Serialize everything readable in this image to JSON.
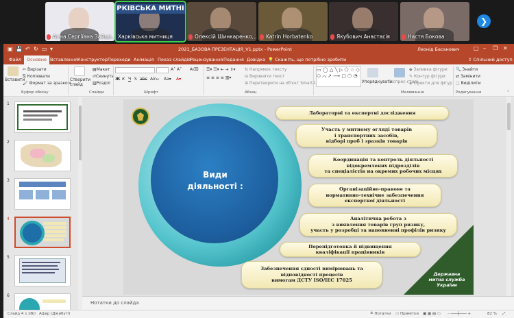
{
  "participants": [
    {
      "name": "Анна Сергіївна Зайце...",
      "muted": true,
      "bg": "#e9e9ef"
    },
    {
      "name": "Харківська митниця",
      "muted": false,
      "bg": "#1f2f4f",
      "banner": "РКІВСЬКА МИТНІ",
      "active": true
    },
    {
      "name": "Олексій Шинкаренко,...",
      "muted": true,
      "bg": "#5a4a3c"
    },
    {
      "name": "Katrin Horbatenko",
      "muted": true,
      "bg": "#6b5a3a"
    },
    {
      "name": "Якубович Анастасія",
      "muted": true,
      "bg": "#3a2f2f"
    },
    {
      "name": "Настя Бокова",
      "muted": true,
      "bg": "#7a6b66"
    }
  ],
  "titlebar": {
    "document": "2021_БАЗОВА ПРЕЗЕНТАЦІЯ_V1.pptx - PowerPoint",
    "user": "Леонід Басанович"
  },
  "tabs": [
    "Файл",
    "Основне",
    "Вставлення",
    "Конструктор",
    "Переходи",
    "Анімація",
    "Показ слайдів",
    "Рецензування",
    "Подання",
    "Довідка",
    "Скажіть, що потрібно зробити"
  ],
  "share_label": "Спільний доступ",
  "ribbon": {
    "paste": "Вставити",
    "cut": "Вирізати",
    "copy": "Копіювати",
    "format_painter": "Формат за зразком",
    "clipboard_group": "Буфер обміну",
    "new_slide": "Створити слайд",
    "layout": "Макет",
    "reset": "Скинути",
    "section": "Розділ",
    "slides_group": "Слайди",
    "font_group": "Шрифт",
    "text_direction": "Напрямок тексту",
    "align_text": "Вирівняти текст",
    "convert_smartart": "Перетворити на об'єкт SmartArt",
    "paragraph_group": "Абзац",
    "arrange": "Упорядкувати",
    "quick_styles": "Експрес-стилі",
    "shape_fill": "Заливка фігури",
    "shape_outline": "Контур фігури",
    "shape_effects": "Ефекти для фігур",
    "drawing_group": "Малювання",
    "find": "Знайти",
    "replace": "Замінити",
    "select": "Виділити",
    "editing_group": "Редагування"
  },
  "slide": {
    "center_title": "Види\nдіяльності :",
    "activities": [
      "Лабораторні та експертні дослідження",
      "Участь у митному огляді товарів\nі транспортних засобів,\nвідборі проб і зразків товарів",
      "Координація та контроль діяльності\nвідокремлених підрозділів\nта спеціалістів на окремих робочих місцях",
      "Організаційно-правове та\nнормативно-технічне забезпечення\nекспертної діяльності",
      "Аналітична робота з\nз виявлення товарів груп ризику,\nучасть у розробці та наповненні профілів ризику",
      "Перепідготовка й підвищення\nкваліфікації працівників",
      "Забезпечення єдності вимірювань та\nвідповідності процесів\nвимогам ДСТУ ISO/IEC 17025"
    ],
    "agency": "Державна\nмитна служба\nУкраїни"
  },
  "thumbnails": [
    "1",
    "2",
    "3",
    "4",
    "5",
    "6"
  ],
  "selected_slide": "4",
  "notes_placeholder": "Нотатки до слайда",
  "status": {
    "slide_info": "Слайд 4 з 16",
    "language": "Афар (Джибуті)",
    "notes": "Нотатки",
    "comments": "Примітки",
    "zoom": "82 %"
  }
}
